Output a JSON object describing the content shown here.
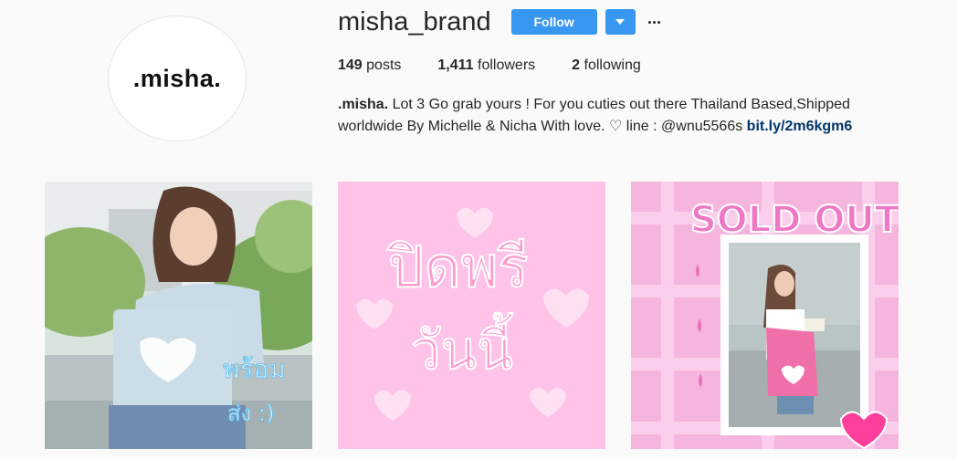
{
  "profile": {
    "avatar_text": ".misha.",
    "username": "misha_brand",
    "follow_label": "Follow"
  },
  "stats": {
    "posts_count": "149",
    "posts_label": "posts",
    "followers_count": "1,411",
    "followers_label": "followers",
    "following_count": "2",
    "following_label": "following"
  },
  "bio": {
    "name": ".misha.",
    "line1": "Lot 3 Go grab yours ! For you cuties out there Thailand Based,Shipped",
    "line2": "worldwide By Michelle & Nicha With love. ♡ line : @wnu5566s",
    "link": "bit.ly/2m6kgm6"
  },
  "posts": [
    {
      "overlay_text_1": "พร้อม",
      "overlay_text_2": "ส่ง :)"
    },
    {
      "overlay_text_1": "ปิดพรี",
      "overlay_text_2": "วันนี้"
    },
    {
      "overlay_text_1": "SOLD OUT"
    }
  ],
  "colors": {
    "accent": "#3897f0",
    "link": "#003569",
    "pink": "#ffc2e8"
  }
}
